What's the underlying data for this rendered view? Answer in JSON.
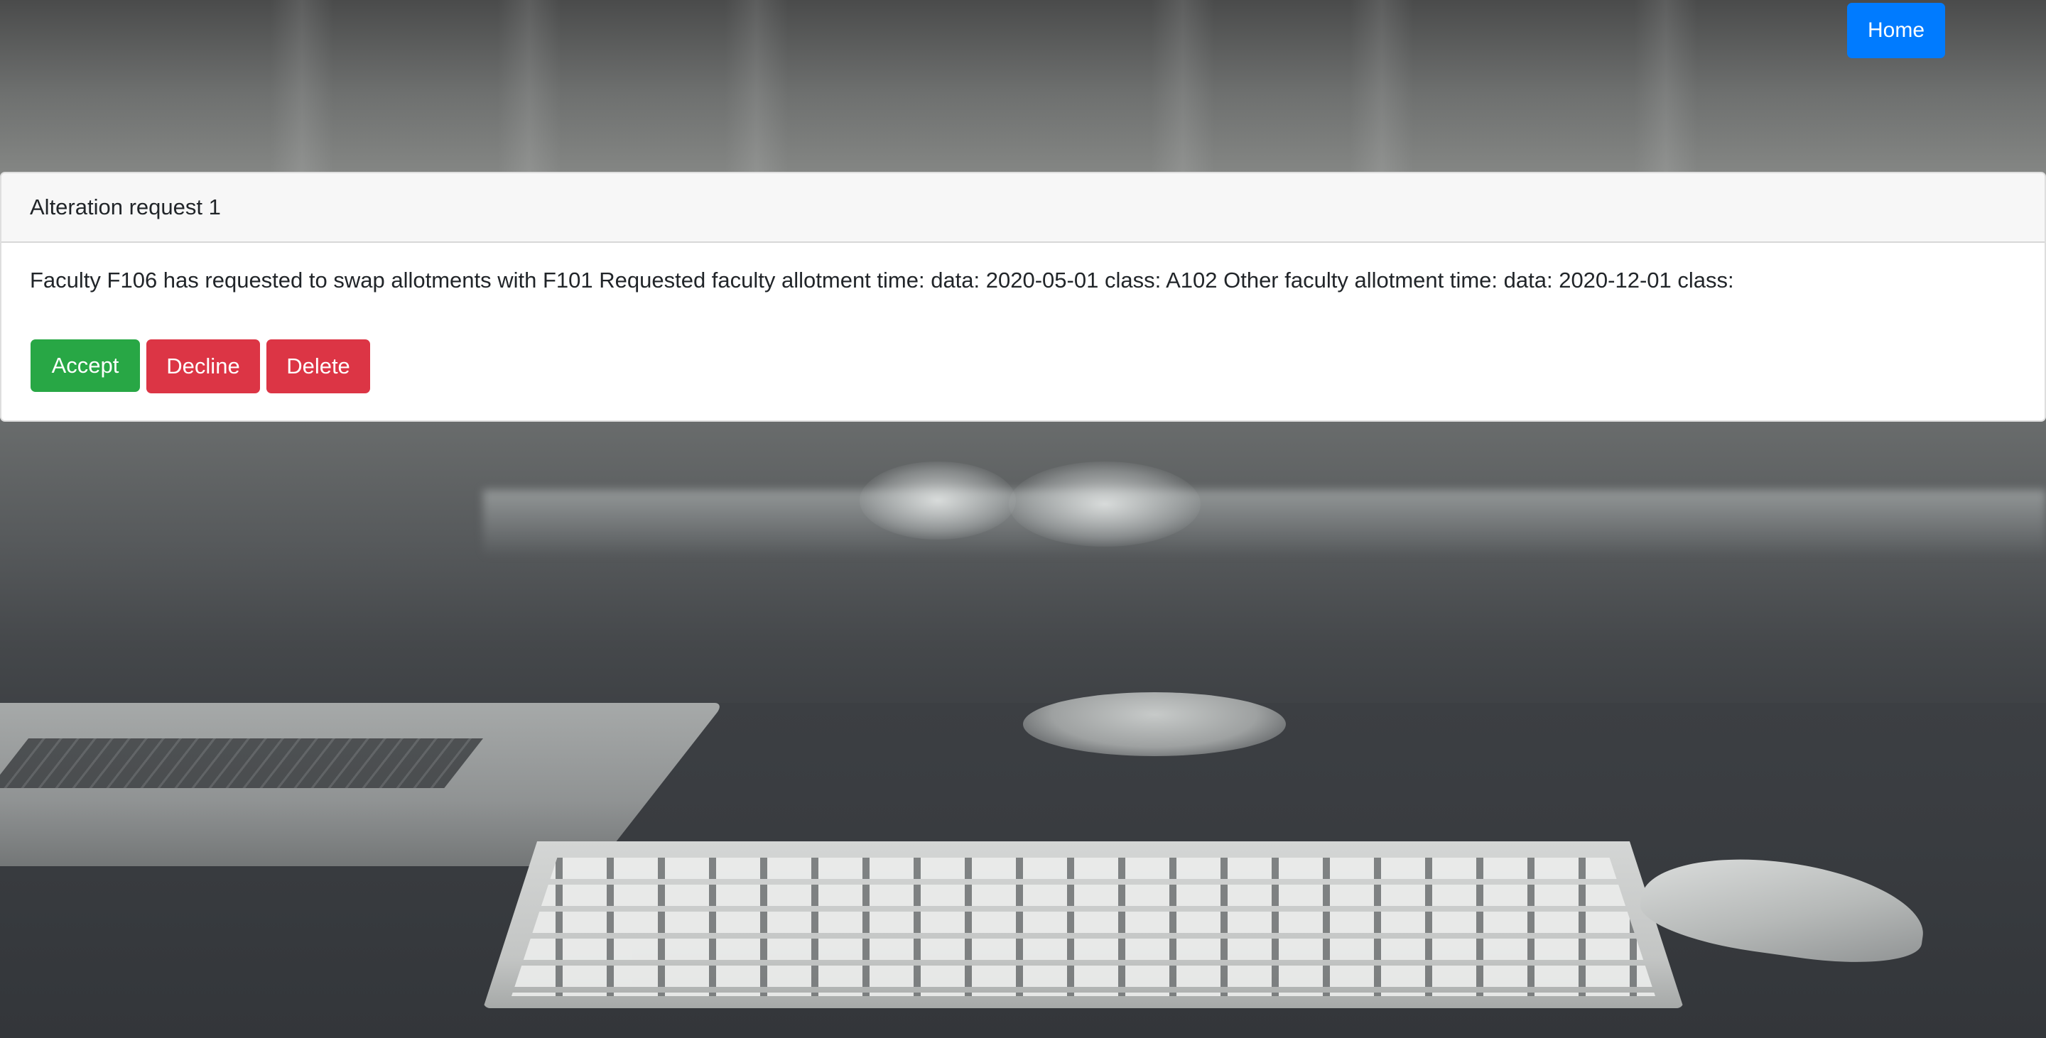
{
  "nav": {
    "home_label": "Home"
  },
  "request": {
    "header": "Alteration request 1",
    "message": "Faculty F106 has requested to swap allotments with F101 Requested faculty allotment time: data: 2020-05-01 class: A102 Other faculty allotment time: data: 2020-12-01 class:",
    "accept_label": "Accept",
    "decline_label": "Decline",
    "delete_label": "Delete"
  },
  "colors": {
    "primary": "#007bff",
    "success": "#28a745",
    "danger": "#dc3545",
    "card_header_bg": "#f7f7f7",
    "text": "#212529"
  }
}
